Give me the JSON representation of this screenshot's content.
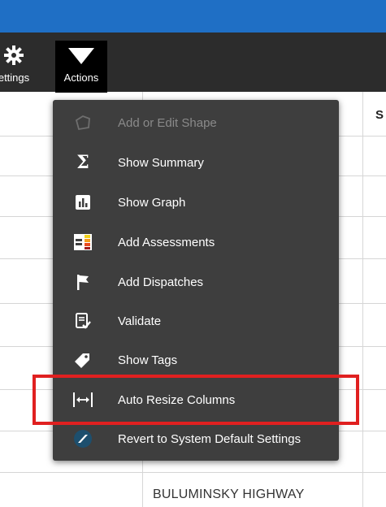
{
  "toolbar": {
    "settings_label": "ettings",
    "actions_label": "Actions"
  },
  "grid": {
    "column_header_partial": "S",
    "bottom_cell": "BULUMINSKY HIGHWAY"
  },
  "menu": {
    "items": [
      {
        "label": "Add or Edit Shape",
        "icon": "shape-icon",
        "disabled": true
      },
      {
        "label": "Show Summary",
        "icon": "sigma-icon",
        "disabled": false
      },
      {
        "label": "Show Graph",
        "icon": "bar-graph-icon",
        "disabled": false
      },
      {
        "label": "Add Assessments",
        "icon": "assessment-icon",
        "disabled": false
      },
      {
        "label": "Add Dispatches",
        "icon": "flag-icon",
        "disabled": false
      },
      {
        "label": "Validate",
        "icon": "validate-icon",
        "disabled": false
      },
      {
        "label": "Show Tags",
        "icon": "tag-icon",
        "disabled": false
      },
      {
        "label": "Auto Resize Columns",
        "icon": "resize-columns-icon",
        "disabled": false
      },
      {
        "label": "Revert to System Default Settings",
        "icon": "revert-icon",
        "disabled": false
      }
    ]
  },
  "colors": {
    "topbar": "#1f6fc5",
    "toolbar": "#2c2c2c",
    "menu_bg": "#3e3e3e",
    "highlight": "#e02020"
  }
}
